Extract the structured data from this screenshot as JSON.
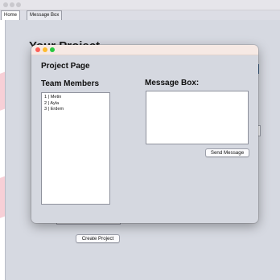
{
  "tabs": [
    {
      "label": "Home",
      "active": true
    },
    {
      "label": "Message Box",
      "active": false
    }
  ],
  "background_window": {
    "title": "Your Project",
    "create_button_label": "Create Project"
  },
  "dialog": {
    "page_title": "Project Page",
    "team_members_label": "Team Members",
    "message_box_label": "Message Box:",
    "members": [
      {
        "number": "1",
        "name": "Metin"
      },
      {
        "number": "2",
        "name": "Ayla"
      },
      {
        "number": "3",
        "name": "Erdem"
      }
    ],
    "message_value": "",
    "send_button_label": "Send Message"
  },
  "colors": {
    "close": "#fe5f57",
    "minimize": "#febc2e",
    "zoom": "#28c840",
    "watermark": "#f7cfd6"
  }
}
